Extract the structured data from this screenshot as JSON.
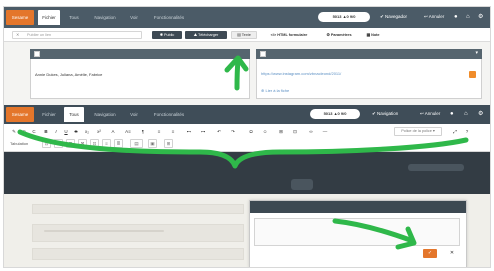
{
  "top": {
    "logo_label": "Sesame",
    "tabs": [
      "Fichier",
      "Tous",
      "Navigation",
      "Voir",
      "Fonctionnalités"
    ],
    "pill_a": "5013 ▲0 9/0",
    "nav_link": "✔ Navegador",
    "back_link": "↩ Annuler",
    "icons": [
      "user-icon",
      "home-icon",
      "settings-icon"
    ]
  },
  "subbar": {
    "search_placeholder": "Publier un lien",
    "btn_public": "✱ Public",
    "btn_upload": "⛰ Télécharger",
    "btn_text": "▤ Texte",
    "btn_html": "</> HTML formulaire",
    "btn_settings": "⚙ Paramètres",
    "btn_note": "▦ Note"
  },
  "panel_left": {
    "text": "Annie Dukes, Juliana, Amélie, Fabrice"
  },
  "panel_right": {
    "url": "https://www.instagram.com/zbnacleond/2011/",
    "add_link": "⊕ Lier à la fiche"
  },
  "middle": {
    "logo_label": "Sesame",
    "tabs": [
      "Fichier",
      "Tous",
      "Navigation",
      "Voir",
      "Fonctionnalités"
    ],
    "pill": "5013 ▲0 9/0",
    "nav_link": "✔ Navigation",
    "back_link": "↩ Annuler"
  },
  "toolbar": {
    "row1": [
      "✎",
      "⊙",
      "C",
      "B",
      "I",
      "U",
      "S",
      "x₂",
      "x²",
      "A",
      "A≡",
      "¶",
      "≡",
      "≡",
      "⊷",
      "⊶",
      "↶",
      "↷",
      "Ω",
      "☺",
      "⊞",
      "⊡",
      "∞",
      "—"
    ],
    "style_select": "Police de la police ▾",
    "label_row2": "Tabulation"
  },
  "dialog": {
    "confirm_label": "✓",
    "cancel_label": "✕"
  },
  "colors": {
    "accent": "#e4762b",
    "header": "#4b5b67",
    "annotation": "#2fb84a"
  }
}
